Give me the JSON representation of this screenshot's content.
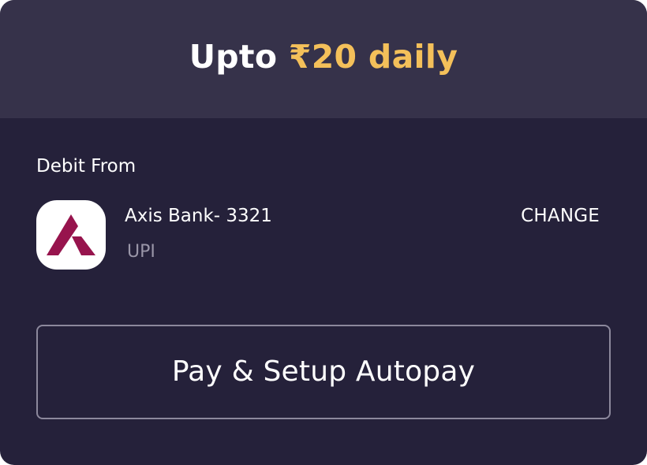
{
  "header": {
    "title_prefix": "Upto ",
    "title_amount": "₹20 daily",
    "amount_color": "#f4c05a"
  },
  "debit": {
    "section_label": "Debit From",
    "bank": {
      "name": "Axis Bank- 3321",
      "method": "UPI",
      "logo_icon": "axis-bank-logo-icon",
      "logo_color": "#97144d"
    },
    "change_label": "CHANGE"
  },
  "action": {
    "pay_label": "Pay & Setup Autopay"
  }
}
